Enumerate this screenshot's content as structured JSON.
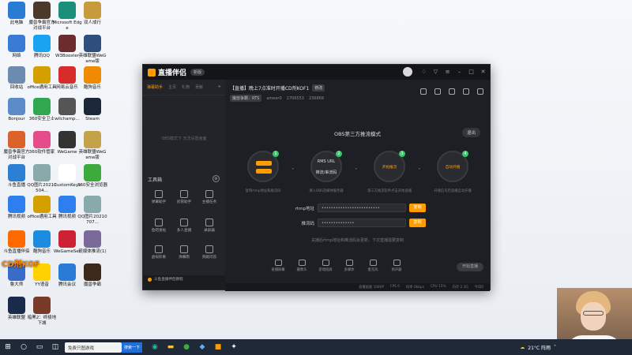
{
  "desktop": {
    "icons": [
      {
        "label": "此电脑",
        "color": "#2a7bd4"
      },
      {
        "label": "魔兽争霸官方对战平台",
        "color": "#4b3a29"
      },
      {
        "label": "Microsoft Edge",
        "color": "#1b8f7a"
      },
      {
        "label": "双人成行",
        "color": "#c79a3b"
      },
      {
        "label": "网络",
        "color": "#3a7bd5"
      },
      {
        "label": "腾讯QQ",
        "color": "#1aa3f0"
      },
      {
        "label": "W3Booster",
        "color": "#6b2d2d"
      },
      {
        "label": "英雄联盟WeGame版",
        "color": "#2f4f7f"
      },
      {
        "label": "回收站",
        "color": "#6b8bb0"
      },
      {
        "label": "office通用工具",
        "color": "#d4a000"
      },
      {
        "label": "网易云音乐",
        "color": "#d82b2b"
      },
      {
        "label": "酷狗音乐",
        "color": "#f08a00"
      },
      {
        "label": "Bonjour",
        "color": "#5b8bc9"
      },
      {
        "label": "360安全卫士",
        "color": "#2fa84f"
      },
      {
        "label": "wilchamp...",
        "color": "#555"
      },
      {
        "label": "Steam",
        "color": "#1b2838"
      },
      {
        "label": "魔兽争霸官方对战平台",
        "color": "#d9632a"
      },
      {
        "label": "360软件管家",
        "color": "#e44d8a"
      },
      {
        "label": "WeGame",
        "color": "#333"
      },
      {
        "label": "英雄联盟WeGame版",
        "color": "#c4a24a"
      },
      {
        "label": "斗鱼直播",
        "color": "#2d7fd3"
      },
      {
        "label": "QQ图片20210504...",
        "color": "#8aa"
      },
      {
        "label": "CustomKeys",
        "color": "#fff"
      },
      {
        "label": "360安全浏览器",
        "color": "#3caa3c"
      },
      {
        "label": "腾讯视频",
        "color": "#2e7ef0"
      },
      {
        "label": "office通用工具",
        "color": "#d4a000"
      },
      {
        "label": "腾讯视频",
        "color": "#2e7ef0"
      },
      {
        "label": "QQ图片20210707...",
        "color": "#8aa"
      },
      {
        "label": "斗鱼直播伴侣",
        "color": "#ff6a00"
      },
      {
        "label": "酷狗音乐",
        "color": "#1c8be0"
      },
      {
        "label": "WeGameSet",
        "color": "#c23"
      },
      {
        "label": "流媒体推流(1)",
        "color": "#7a6a9a"
      },
      {
        "label": "鲁大师",
        "color": "#3b6bc9"
      },
      {
        "label": "YY语音",
        "color": "#ffd200"
      },
      {
        "label": "腾讯会议",
        "color": "#2a7bd4"
      },
      {
        "label": "魔兽争霸",
        "color": "#3b2a1a"
      },
      {
        "label": "英雄联盟",
        "color": "#1a2a4a"
      },
      {
        "label": "暗黑2：终极地下城",
        "color": "#7a3a2a"
      }
    ],
    "overlay_text": "CD剂KOF"
  },
  "app": {
    "logo": "直播伴侣",
    "version": "新版",
    "left_tabs": [
      "弹幕助手",
      "主页",
      "礼物",
      "贡献"
    ],
    "left_placeholder": "OBS模式下 无法设置画面",
    "tools_heading": "工具箱",
    "tools": [
      "弹幕助手",
      "房管助手",
      "主播任务",
      "鱼吧发帖",
      "多人直播",
      "录屏器",
      "虚拟形象",
      "弹幕雨",
      "贡献问答"
    ],
    "hot_notice": "斗鱼直播伴侣教程",
    "room_title": "【直播】晚上7点准时开播CD剂KOF1",
    "edit_label": "修改",
    "category": "魔兽争霸：RTS",
    "uid": "ameer0",
    "follower_count": "1706553",
    "hot_value": "236868",
    "exit_button": "退出",
    "obs_mode_title": "OBS第三方推流模式",
    "steps": [
      {
        "num": "1",
        "text": "复制",
        "caption": "复制rtmp地址和推流码"
      },
      {
        "num": "2",
        "text": "RMS URL",
        "sub": "推流/串流码",
        "caption": "填入OBS流媒体服务器"
      },
      {
        "num": "3",
        "text": "开始推流",
        "caption": "第三方推流软件点击开始直播"
      },
      {
        "num": "4",
        "text": "自动开播",
        "caption": "开播信号后直播自动开播"
      }
    ],
    "rtmp_label": "rtmp地址",
    "rtmp_value": "•••••••••••••••••••••••••",
    "stream_key_label": "推流码",
    "stream_key_value": "••••••••••••••",
    "copy_label": "复制",
    "hint": "关播后rtmp地址和推流码会更新，下次直播需要复制",
    "bottom_tools": [
      "直播屏幕",
      "摄像头",
      "游戏投屏",
      "多媒体",
      "麦克风",
      "扬声器"
    ],
    "start_button": "开始直播",
    "status": [
      "直播画面 1080P",
      "FPS 0",
      "码率 0kbps",
      "CPU 15%",
      "内存 2.3G",
      "今日0"
    ]
  },
  "taskbar": {
    "search_placeholder": "免费只图游戏",
    "search_button": "搜索一下",
    "weather": "21°C 阵雨"
  }
}
